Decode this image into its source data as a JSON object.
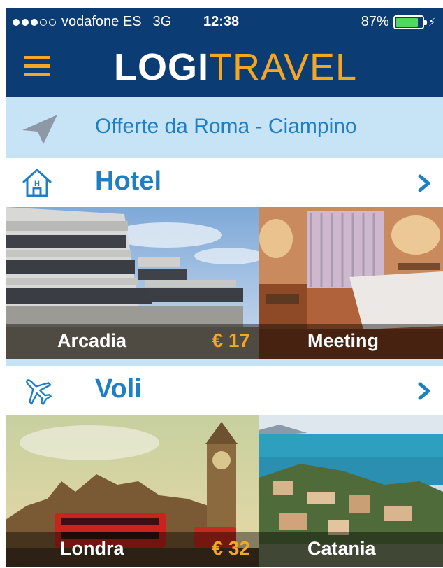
{
  "status_bar": {
    "carrier": "vodafone ES",
    "network": "3G",
    "time": "12:38",
    "battery": "87%",
    "battery_level": 0.87
  },
  "header": {
    "menu_icon": "hamburger-menu-icon",
    "logo_part1": "LOGI",
    "logo_part2": "TRAVEL"
  },
  "location": {
    "icon": "location-arrow-icon",
    "label": "Offerte da Roma - Ciampino"
  },
  "sections": {
    "hotel": {
      "icon": "hotel-house-icon",
      "title": "Hotel",
      "tiles": [
        {
          "name": "Arcadia",
          "price": "€ 17"
        },
        {
          "name": "Meeting",
          "price": ""
        }
      ]
    },
    "flights": {
      "icon": "airplane-icon",
      "title": "Voli",
      "tiles": [
        {
          "name": "Londra",
          "price": "€ 32"
        },
        {
          "name": "Catania",
          "price": ""
        }
      ]
    }
  },
  "colors": {
    "navy": "#0b3c74",
    "accent_orange": "#f5a623",
    "link_blue": "#1f7fc4",
    "light_blue": "#c7e4f6"
  }
}
